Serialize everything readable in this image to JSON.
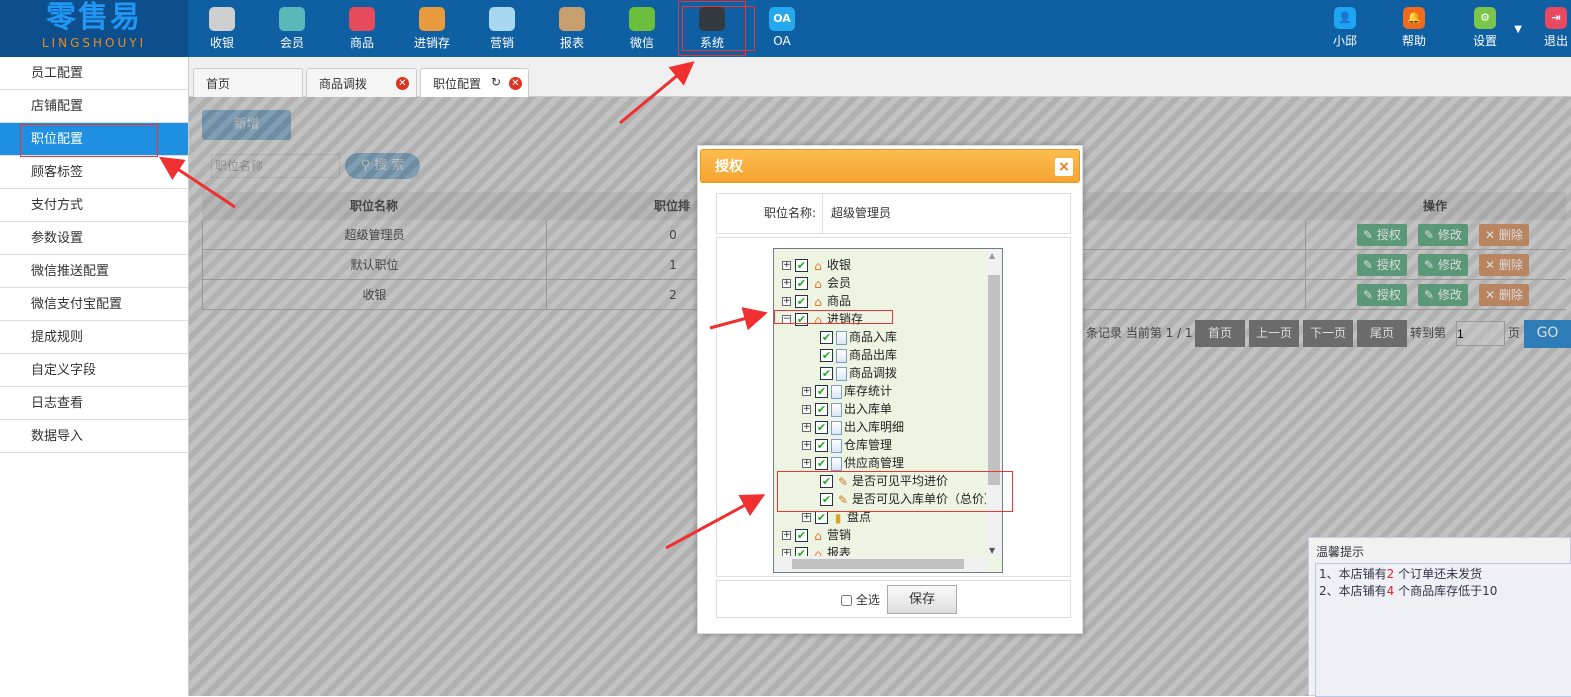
{
  "logo": {
    "cn": "零售易",
    "en": "LINGSHOUYI"
  },
  "nav": [
    {
      "label": "收银",
      "icon": "cash-register-icon",
      "color": "#cfcfcf"
    },
    {
      "label": "会员",
      "icon": "member-icon",
      "color": "#5bb8b8"
    },
    {
      "label": "商品",
      "icon": "product-icon",
      "color": "#e54b5a"
    },
    {
      "label": "进销存",
      "icon": "inventory-icon",
      "color": "#e89a3c"
    },
    {
      "label": "营销",
      "icon": "megaphone-icon",
      "color": "#a8d8f0"
    },
    {
      "label": "报表",
      "icon": "report-icon",
      "color": "#c8a070"
    },
    {
      "label": "微信",
      "icon": "wechat-icon",
      "color": "#6cbf3c"
    },
    {
      "label": "系统",
      "icon": "monitor-icon",
      "color": "#333a40"
    },
    {
      "label": "OA",
      "icon": "oa-icon",
      "color": "#25a8ee",
      "glyph": "OA"
    }
  ],
  "right_nav": [
    {
      "label": "小邱",
      "icon": "user-icon",
      "color": "#1da5f2",
      "glyph": "👤"
    },
    {
      "label": "帮助",
      "icon": "bell-icon",
      "color": "#f26a1b",
      "glyph": "🔔"
    },
    {
      "label": "设置",
      "icon": "gear-icon",
      "color": "#7bc64a",
      "glyph": "⚙"
    },
    {
      "label": "退出",
      "icon": "logout-icon",
      "color": "#e84860",
      "glyph": "⇥"
    }
  ],
  "sidebar": [
    "员工配置",
    "店铺配置",
    "职位配置",
    "顾客标签",
    "支付方式",
    "参数设置",
    "微信推送配置",
    "微信支付宝配置",
    "提成规则",
    "自定义字段",
    "日志查看",
    "数据导入"
  ],
  "tabs": [
    "首页",
    "商品调拨",
    "职位配置"
  ],
  "toolbar": {
    "add": "新增",
    "search_placeholder": "职位名称",
    "search": "搜 索"
  },
  "table": {
    "headers": [
      "职位名称",
      "职位排",
      "操作"
    ],
    "rows": [
      [
        "超级管理员",
        "0"
      ],
      [
        "默认职位",
        "1"
      ],
      [
        "收银",
        "2"
      ]
    ],
    "ops": [
      "授权",
      "修改",
      "删除"
    ]
  },
  "pager": {
    "info": "条记录 当前第 1 / 1",
    "first": "首页",
    "prev": "上一页",
    "next": "下一页",
    "last": "尾页",
    "goto": "转到第",
    "page_value": "1",
    "page_unit": "页",
    "go": "GO"
  },
  "modal": {
    "title": "授权",
    "close": "×",
    "role_label": "职位名称:",
    "role_value": "超级管理员",
    "tree": [
      {
        "label": "收银",
        "level": 0,
        "toggle": "+",
        "icon": "home"
      },
      {
        "label": "会员",
        "level": 0,
        "toggle": "+",
        "icon": "home"
      },
      {
        "label": "商品",
        "level": 0,
        "toggle": "+",
        "icon": "home"
      },
      {
        "label": "进销存",
        "level": 0,
        "toggle": "−",
        "icon": "home"
      },
      {
        "label": "商品入库",
        "level": 1,
        "toggle": "",
        "icon": "doc"
      },
      {
        "label": "商品出库",
        "level": 1,
        "toggle": "",
        "icon": "doc"
      },
      {
        "label": "商品调拨",
        "level": 1,
        "toggle": "",
        "icon": "doc"
      },
      {
        "label": "库存统计",
        "level": 1,
        "toggle": "+",
        "icon": "doc"
      },
      {
        "label": "出入库单",
        "level": 1,
        "toggle": "+",
        "icon": "doc"
      },
      {
        "label": "出入库明细",
        "level": 1,
        "toggle": "+",
        "icon": "doc"
      },
      {
        "label": "仓库管理",
        "level": 1,
        "toggle": "+",
        "icon": "doc"
      },
      {
        "label": "供应商管理",
        "level": 1,
        "toggle": "+",
        "icon": "doc"
      },
      {
        "label": "是否可见平均进价",
        "level": 1,
        "toggle": "",
        "icon": "pen"
      },
      {
        "label": "是否可见入库单价（总价）",
        "level": 1,
        "toggle": "",
        "icon": "pen"
      },
      {
        "label": "盘点",
        "level": 1,
        "toggle": "+",
        "icon": "folder"
      },
      {
        "label": "营销",
        "level": 0,
        "toggle": "+",
        "icon": "home"
      },
      {
        "label": "报表",
        "level": 0,
        "toggle": "+",
        "icon": "home"
      }
    ],
    "select_all": "全选",
    "save": "保存"
  },
  "tip": {
    "title": "温馨提示",
    "lines": [
      {
        "pre": "1、本店铺有",
        "num": "2",
        "post": " 个订单还未发货"
      },
      {
        "pre": "2、本店铺有",
        "num": "4",
        "post": " 个商品库存低于10"
      }
    ]
  }
}
